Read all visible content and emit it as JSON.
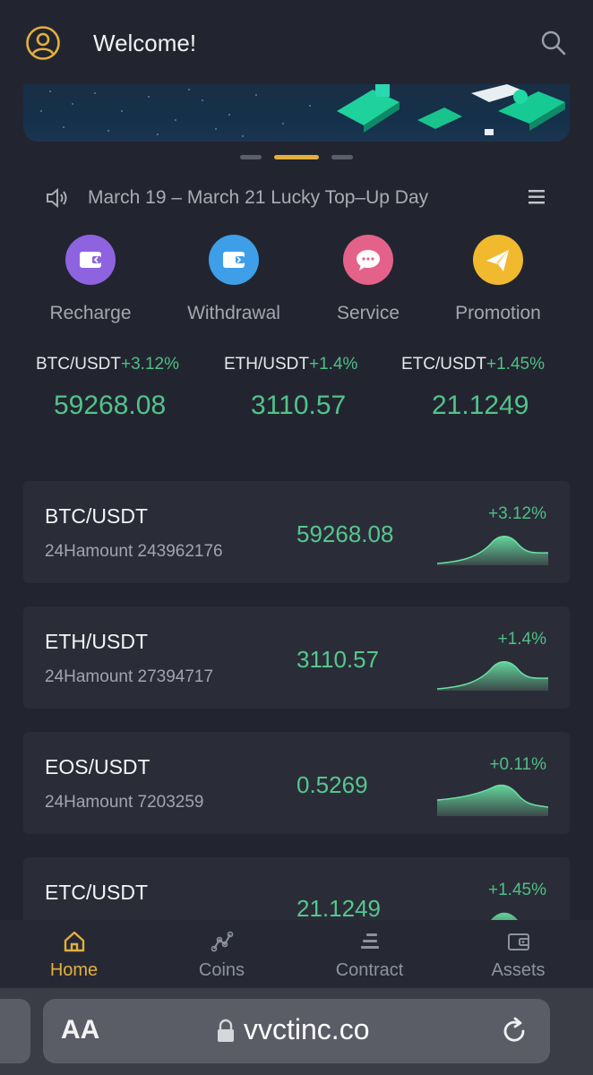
{
  "header": {
    "welcome": "Welcome!",
    "icons": {
      "avatar": "user-circle-icon",
      "search": "search-icon"
    }
  },
  "banner": {
    "carousel_dots": 3,
    "active_dot": 2
  },
  "notice": {
    "text": "March 19 – March 21 Lucky Top–Up Day",
    "icons": {
      "speaker": "speaker-icon",
      "menu": "hamburger-menu-icon"
    }
  },
  "actions": [
    {
      "label": "Recharge",
      "icon": "wallet-in-icon",
      "color": "#8e63e0"
    },
    {
      "label": "Withdrawal",
      "icon": "wallet-out-icon",
      "color": "#3e9ee8"
    },
    {
      "label": "Service",
      "icon": "chat-bubble-icon",
      "color": "#e4628a"
    },
    {
      "label": "Promotion",
      "icon": "paper-plane-icon",
      "color": "#f0b92e"
    }
  ],
  "tickers": [
    {
      "pair": "BTC/USDT",
      "change": "+3.12%",
      "price": "59268.08"
    },
    {
      "pair": "ETH/USDT",
      "change": "+1.4%",
      "price": "3110.57"
    },
    {
      "pair": "ETC/USDT",
      "change": "+1.45%",
      "price": "21.1249"
    }
  ],
  "markets": [
    {
      "symbol": "BTC/USDT",
      "amount": "24Hamount 243962176",
      "price": "59268.08",
      "change": "+3.12%"
    },
    {
      "symbol": "ETH/USDT",
      "amount": "24Hamount 27394717",
      "price": "3110.57",
      "change": "+1.4%"
    },
    {
      "symbol": "EOS/USDT",
      "amount": "24Hamount 7203259",
      "price": "0.5269",
      "change": "+0.11%"
    },
    {
      "symbol": "ETC/USDT",
      "amount": "",
      "price": "21.1249",
      "change": "+1.45%"
    }
  ],
  "tabs": [
    {
      "label": "Home",
      "icon": "home-icon",
      "active": true
    },
    {
      "label": "Coins",
      "icon": "chart-line-icon",
      "active": false
    },
    {
      "label": "Contract",
      "icon": "stack-icon",
      "active": false
    },
    {
      "label": "Assets",
      "icon": "wallet-icon",
      "active": false
    }
  ],
  "browser": {
    "text_size": "AA",
    "url": "vvctinc.co",
    "icons": {
      "lock": "lock-icon",
      "reload": "reload-icon"
    }
  },
  "colors": {
    "accent": "#e3b03c",
    "positive": "#52c38a",
    "background": "#22252f",
    "card": "#2a2d38"
  }
}
